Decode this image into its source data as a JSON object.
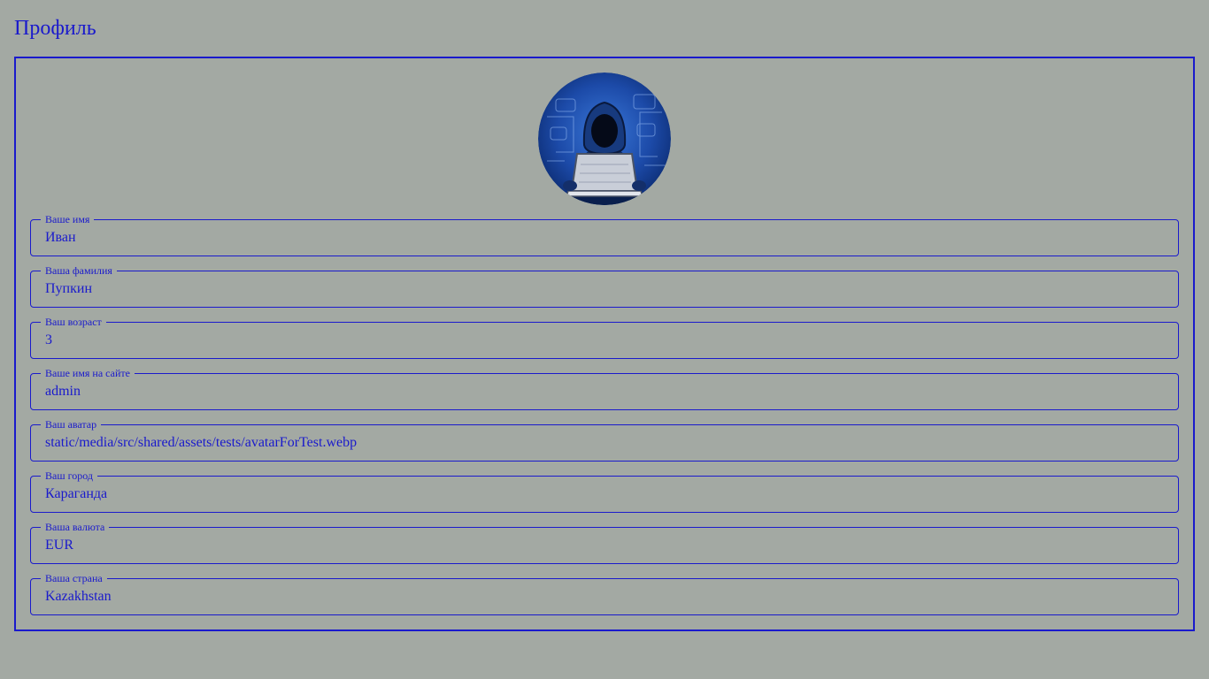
{
  "page": {
    "title": "Профиль"
  },
  "profile": {
    "avatar_icon": "hooded-hacker-laptop-icon",
    "fields": [
      {
        "label": "Ваше имя",
        "value": "Иван"
      },
      {
        "label": "Ваша фамилия",
        "value": "Пупкин"
      },
      {
        "label": "Ваш возраст",
        "value": "3"
      },
      {
        "label": "Ваше имя на сайте",
        "value": "admin"
      },
      {
        "label": "Ваш аватар",
        "value": "static/media/src/shared/assets/tests/avatarForTest.webp"
      },
      {
        "label": "Ваш город",
        "value": "Караганда"
      },
      {
        "label": "Ваша валюта",
        "value": "EUR"
      },
      {
        "label": "Ваша страна",
        "value": "Kazakhstan"
      }
    ]
  },
  "colors": {
    "background": "#a3a9a3",
    "accent": "#1a1acc"
  }
}
